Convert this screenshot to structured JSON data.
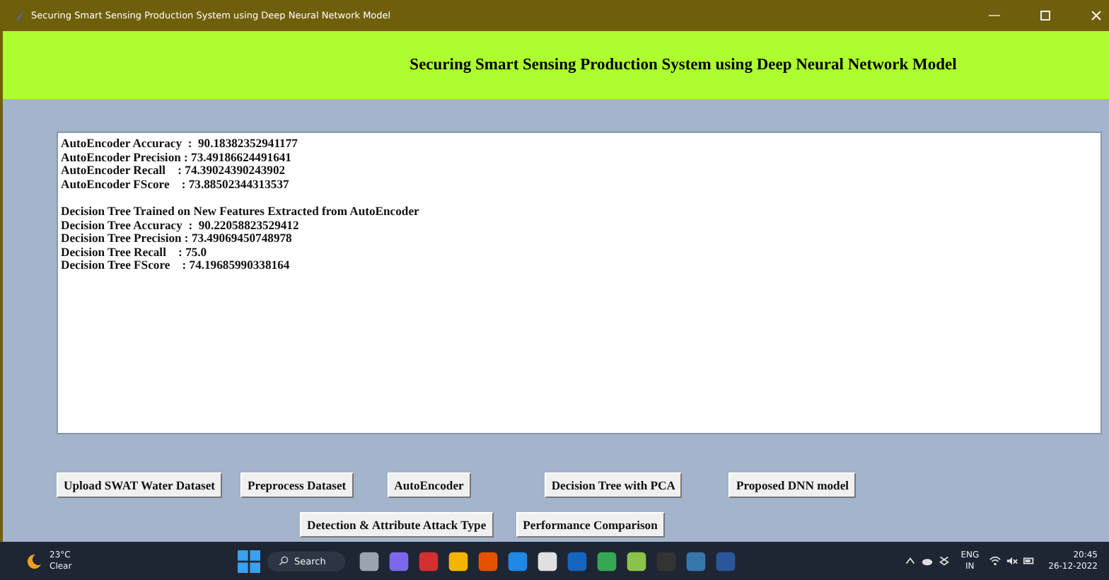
{
  "window": {
    "title": "Securing Smart Sensing Production System using Deep Neural Network Model"
  },
  "header": {
    "title": "Securing Smart Sensing Production System using Deep Neural Network Model"
  },
  "output_blocks": [
    [
      "AutoEncoder Accuracy  :  90.18382352941177",
      "AutoEncoder Precision : 73.49186624491641",
      "AutoEncoder Recall    : 74.39024390243902",
      "AutoEncoder FScore    : 73.88502344313537"
    ],
    [
      "Decision Tree Trained on New Features Extracted from AutoEncoder",
      "Decision Tree Accuracy  :  90.22058823529412",
      "Decision Tree Precision : 73.49069450748978",
      "Decision Tree Recall    : 75.0",
      "Decision Tree FScore    : 74.19685990338164"
    ]
  ],
  "buttons_row_1": [
    "Upload SWAT Water Dataset",
    "Preprocess Dataset",
    "AutoEncoder",
    "Decision Tree with PCA",
    "Proposed DNN model"
  ],
  "buttons_row_2": [
    "Detection & Attribute Attack Type",
    "Performance Comparison"
  ],
  "taskbar": {
    "temperature": "23°C",
    "weather": "Clear",
    "search": "Search",
    "language": "ENG",
    "region": "IN",
    "time": "20:45",
    "date": "26-12-2022"
  }
}
